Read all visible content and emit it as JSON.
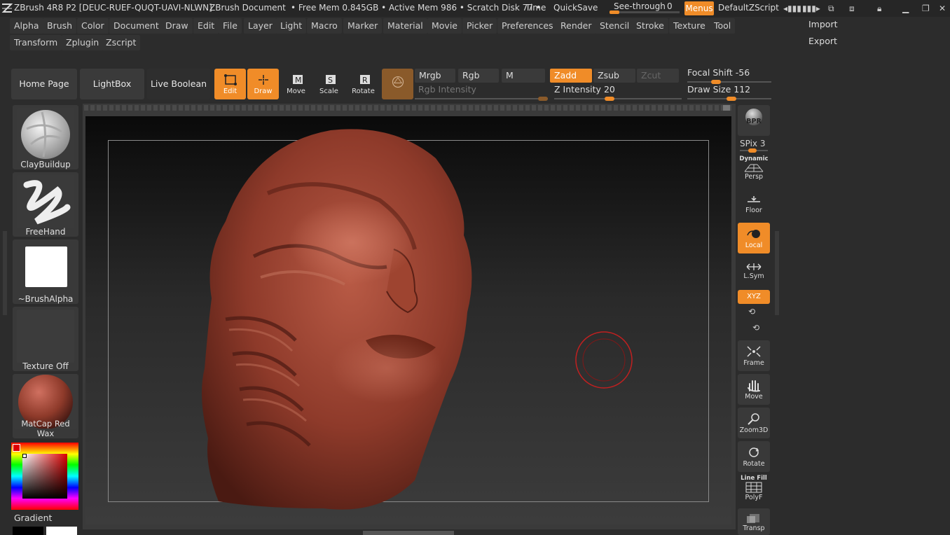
{
  "titlebar": {
    "app": "ZBrush 4R8 P2 [DEUC-RUEF-QUQT-UAVI-NLWN]",
    "doc": "ZBrush Document",
    "mem": "• Free Mem 0.845GB • Active Mem 986 • Scratch Disk 77 •",
    "time": "Time",
    "quicksave": "QuickSave",
    "seethrough_label": "See-through",
    "seethrough_value": "0",
    "menus": "Menus",
    "script": "DefaultZScript"
  },
  "menubar": {
    "row1": [
      "Alpha",
      "Brush",
      "Color",
      "Document",
      "Draw",
      "Edit",
      "File",
      "Layer",
      "Light",
      "Macro",
      "Marker",
      "Material",
      "Movie",
      "Picker",
      "Preferences",
      "Render",
      "Stencil",
      "Stroke",
      "Texture",
      "Tool"
    ],
    "row2": [
      "Transform",
      "Zplugin",
      "Zscript"
    ]
  },
  "rightmenu": {
    "import": "Import",
    "export": "Export"
  },
  "shelf": {
    "home": "Home Page",
    "lightbox": "LightBox",
    "liveboolean": "Live Boolean",
    "edit": "Edit",
    "draw": "Draw",
    "move": "Move",
    "scale": "Scale",
    "rotate": "Rotate",
    "mrgb": "Mrgb",
    "rgb": "Rgb",
    "m": "M",
    "rgb_intensity": "Rgb Intensity",
    "zadd": "Zadd",
    "zsub": "Zsub",
    "zcut": "Zcut",
    "z_intensity_label": "Z Intensity",
    "z_intensity": "20",
    "focal_label": "Focal Shift",
    "focal": "-56",
    "drawsize_label": "Draw Size",
    "drawsize": "112"
  },
  "left": {
    "brush": "ClayBuildup",
    "stroke": "FreeHand",
    "alpha": "~BrushAlpha",
    "texture": "Texture Off",
    "material": "MatCap Red Wax",
    "gradient": "Gradient"
  },
  "right": {
    "bpr": "BPR",
    "spix_label": "SPix",
    "spix": "3",
    "dynamic": "Dynamic",
    "persp": "Persp",
    "floor": "Floor",
    "local": "Local",
    "lsym": "L.Sym",
    "xyz": "XYZ",
    "frame": "Frame",
    "move": "Move",
    "zoom3d": "Zoom3D",
    "rotate": "Rotate",
    "linefill": "Line Fill",
    "polyf": "PolyF",
    "transp": "Transp"
  },
  "colors": {
    "accent": "#f08c28",
    "wax": "#8e3a2a"
  }
}
